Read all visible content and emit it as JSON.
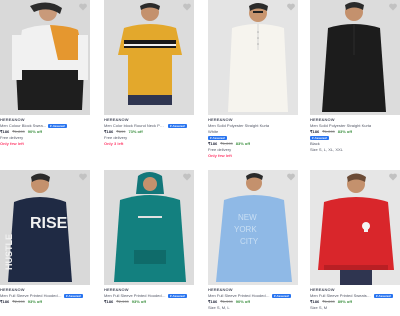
{
  "colors": {
    "assured_bg": "#2874f0",
    "discount": "#388e3c",
    "urgency": "#ff3f6c"
  },
  "badge": {
    "assured": "F Assured"
  },
  "products": [
    {
      "brand": "HERE&NOW",
      "title": "Men Colour Block Swea...",
      "assured": true,
      "price": "₹186",
      "mrp": "₹1,899",
      "off": "90% off",
      "note1": "Free delivery",
      "note2": "Only few left",
      "icon": "wishlist-heart-icon"
    },
    {
      "brand": "HERE&NOW",
      "title": "Men Color block Round Neck Pure ...",
      "assured": true,
      "price": "₹186",
      "mrp": "₹699",
      "off": "73% off",
      "note1": "Free delivery",
      "note2": "Only 3 left",
      "icon": "wishlist-heart-icon"
    },
    {
      "brand": "HERE&NOW",
      "title": "Men Solid Polyester Straight Kurta",
      "sub": "White",
      "assured": true,
      "price": "₹186",
      "mrp": "₹1,099",
      "off": "83% off",
      "note1": "Free delivery",
      "note2": "Only few left",
      "icon": "wishlist-heart-icon"
    },
    {
      "brand": "HERE&NOW",
      "title": "Men Solid Polyester Straight Kurta",
      "sub": "Black",
      "assured": true,
      "price": "₹186",
      "mrp": "₹1,099",
      "off": "83% off",
      "note1": "Size S, L, XL, XXL",
      "icon": "wishlist-heart-icon"
    },
    {
      "brand": "HERE&NOW",
      "title": "Men Full Sleeve Printed Hooded S...",
      "assured": true,
      "price": "₹186",
      "mrp": "₹2,999",
      "off": "93% off",
      "icon": "wishlist-heart-icon"
    },
    {
      "brand": "HERE&NOW",
      "title": "Men Full Sleeve Printed Hooded S...",
      "assured": true,
      "price": "₹186",
      "mrp": "₹2,999",
      "off": "93% off",
      "icon": "wishlist-heart-icon"
    },
    {
      "brand": "HERE&NOW",
      "title": "Men Full Sleeve Printed Hooded S...",
      "assured": true,
      "price": "₹186",
      "mrp": "₹1,999",
      "off": "90% off",
      "note1": "Size S, M, L",
      "icon": "wishlist-heart-icon"
    },
    {
      "brand": "HERE&NOW",
      "title": "Men Full Sleeve Printed Sweatshirt",
      "assured": true,
      "price": "₹186",
      "mrp": "₹1,699",
      "off": "89% off",
      "note1": "Size S, M",
      "icon": "wishlist-heart-icon"
    }
  ]
}
